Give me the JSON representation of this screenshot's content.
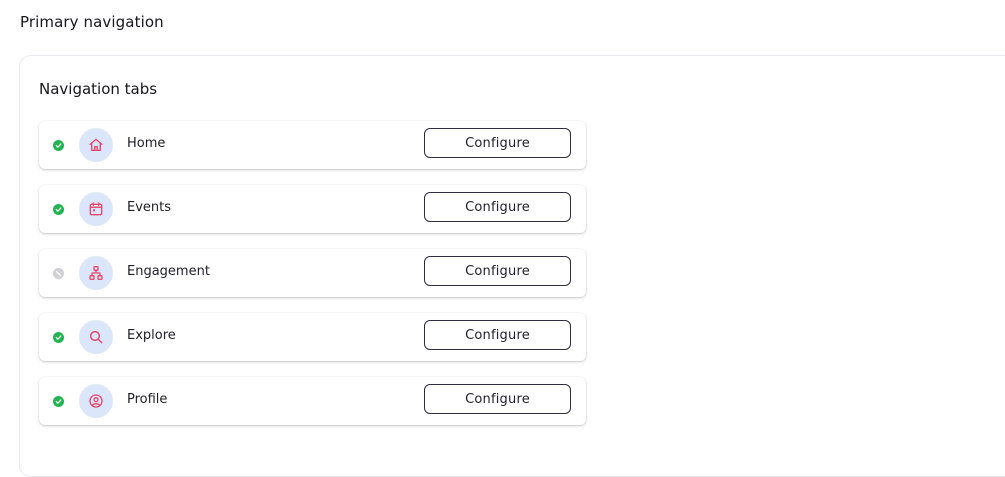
{
  "page": {
    "title": "Primary navigation"
  },
  "panel": {
    "title": "Navigation tabs"
  },
  "colors": {
    "enabled": "#22b455",
    "disabled": "#cfcfd4",
    "icon_accent": "#e5486a",
    "icon_bg": "#dbe6fb"
  },
  "tabs": [
    {
      "label": "Home",
      "icon": "home-icon",
      "status": "enabled",
      "action_label": "Configure"
    },
    {
      "label": "Events",
      "icon": "calendar-icon",
      "status": "enabled",
      "action_label": "Configure"
    },
    {
      "label": "Engagement",
      "icon": "hierarchy-icon",
      "status": "disabled",
      "action_label": "Configure"
    },
    {
      "label": "Explore",
      "icon": "search-icon",
      "status": "enabled",
      "action_label": "Configure"
    },
    {
      "label": "Profile",
      "icon": "user-circle-icon",
      "status": "enabled",
      "action_label": "Configure"
    }
  ]
}
